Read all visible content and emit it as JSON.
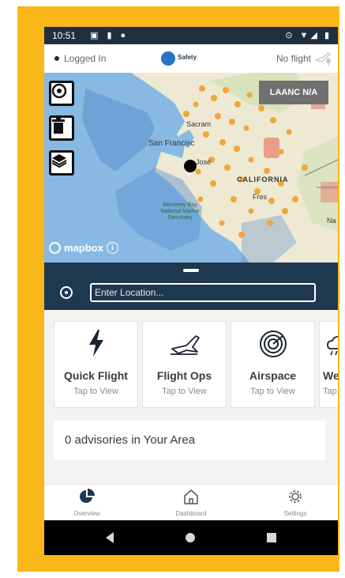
{
  "status_bar": {
    "time": "10:51"
  },
  "header": {
    "login_status": "Logged In",
    "logo_text": "Safety",
    "flight_status": "No flight"
  },
  "map": {
    "laanc_label": "LAANC N/A",
    "mapbox_label": "mapbox",
    "place_labels": {
      "sacramento": "Sacram",
      "san_francisco": "San Francisc",
      "san_jose": "José",
      "california": "CALIFORNIA",
      "fresno": "Fres",
      "monterey": "Monterey Bay National Marine Sanctuary",
      "na": "Na"
    },
    "buttons": [
      "target-icon",
      "trash-icon",
      "layers-icon"
    ]
  },
  "location": {
    "placeholder": "Enter Location..."
  },
  "cards": [
    {
      "title": "Quick Flight",
      "subtitle": "Tap to View",
      "icon": "lightning-icon"
    },
    {
      "title": "Flight Ops",
      "subtitle": "Tap to View",
      "icon": "plane-icon"
    },
    {
      "title": "Airspace",
      "subtitle": "Tap to View",
      "icon": "radar-icon"
    },
    {
      "title": "Weath",
      "subtitle": "Tap to Vi",
      "icon": "weather-icon"
    }
  ],
  "advisories": {
    "text": "0 advisories in Your Area"
  },
  "bottom_nav": [
    {
      "label": "Overview",
      "icon": "pie-chart-icon"
    },
    {
      "label": "Dashboard",
      "icon": "home-icon"
    },
    {
      "label": "Settings",
      "icon": "gear-icon"
    }
  ],
  "colors": {
    "frame": "#f9b719",
    "header_dark": "#1e3850",
    "laanc": "#707070",
    "water": "#87b9e3",
    "airport_dots": "#f0a63a"
  }
}
